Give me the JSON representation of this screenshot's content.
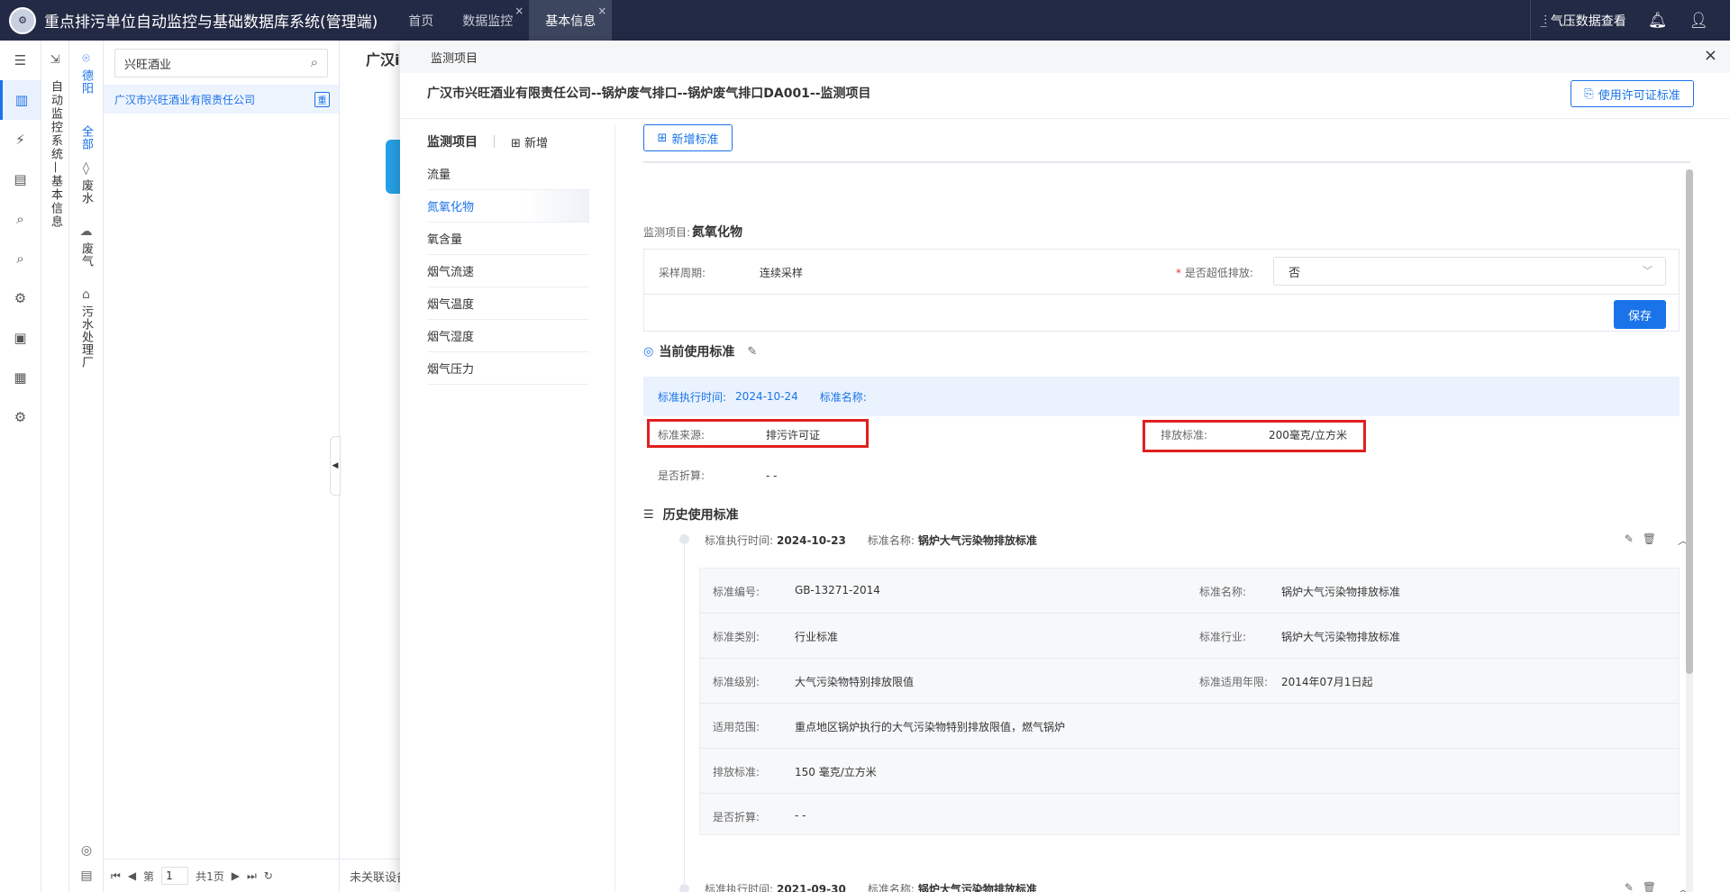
{
  "topbar": {
    "app_title": "重点排污单位自动监控与基础数据库系统(管理端)",
    "tabs": [
      {
        "label": "首页",
        "active": false,
        "closable": false
      },
      {
        "label": "数据监控",
        "active": false,
        "closable": true
      },
      {
        "label": "基本信息",
        "active": true,
        "closable": true
      }
    ],
    "close_glyph": "×",
    "right_label": "气压数据查看",
    "right_icons": [
      "chart-icon",
      "bell-icon",
      "user-icon"
    ]
  },
  "rail1": {
    "icons": [
      "menu-icon",
      "dashboard-icon",
      "money-icon",
      "report-icon",
      "search-doc-icon",
      "search-doc2-icon",
      "settings-icon",
      "image-icon",
      "card-icon",
      "config-icon"
    ]
  },
  "rail2": {
    "text": "自动监控系统—基本信息"
  },
  "rail3": {
    "items": [
      {
        "icon": "location-icon",
        "label": "德阳",
        "blue": true
      },
      {
        "icon": "",
        "label": "全部",
        "blue": true
      },
      {
        "icon": "water-drop-icon",
        "label": "废水",
        "blue": false
      },
      {
        "icon": "cloud-icon",
        "label": "废气",
        "blue": false
      },
      {
        "icon": "home-icon",
        "label": "污水处理厂",
        "blue": false
      }
    ]
  },
  "tree": {
    "search_value": "兴旺酒业",
    "company": "广汉市兴旺酒业有限责任公司",
    "badge": "重",
    "pager": {
      "prefix": "第",
      "page": "1",
      "total": "共1页"
    }
  },
  "background": {
    "title": "广汉i",
    "footer": "未关联设备"
  },
  "modal": {
    "header": "监测项目",
    "close": "×",
    "title": "广汉市兴旺酒业有限责任公司--锅炉废气排口--锅炉废气排口DA001--监测项目",
    "permit_button": "使用许可证标准",
    "list": {
      "header": "监测项目",
      "add": "新增",
      "items": [
        "流量",
        "氮氧化物",
        "氧含量",
        "烟气流速",
        "烟气温度",
        "烟气湿度",
        "烟气压力"
      ],
      "selected": 1
    },
    "add_standard_button": "新增标准",
    "project_label": "监测项目:",
    "project_value": "氮氧化物",
    "form": {
      "period_label": "采样周期:",
      "period_value": "连续采样",
      "required_mark": "*",
      "over_label": "是否超低排放:",
      "over_value": "否",
      "save": "保存"
    },
    "current": {
      "title": "当前使用标准",
      "exec_time_label": "标准执行时间:",
      "exec_time_value": "2024-10-24",
      "name_label": "标准名称:",
      "name_value": "",
      "source_label": "标准来源:",
      "source_value": "排污许可证",
      "emission_label": "排放标准:",
      "emission_value": "200毫克/立方米",
      "discount_label": "是否折算:",
      "discount_value": "- -"
    },
    "history": {
      "title": "历史使用标准",
      "entries": [
        {
          "time_label": "标准执行时间:",
          "time": "2024-10-23",
          "name_label": "标准名称:",
          "name": "锅炉大气污染物排放标准"
        },
        {
          "time_label": "标准执行时间:",
          "time": "2021-09-30",
          "name_label": "标准名称:",
          "name": "锅炉大气污染物排放标准"
        }
      ],
      "detail": {
        "code_label": "标准编号:",
        "code": "GB-13271-2014",
        "std_name_label": "标准名称:",
        "std_name": "锅炉大气污染物排放标准",
        "type_label": "标准类别:",
        "type": "行业标准",
        "industry_label": "标准行业:",
        "industry": "锅炉大气污染物排放标准",
        "level_label": "标准级别:",
        "level": "大气污染物特别排放限值",
        "year_label": "标准适用年限:",
        "year": "2014年07月1日起",
        "scope_label": "适用范围:",
        "scope": "重点地区锅炉执行的大气污染物特别排放限值，燃气锅炉",
        "emission_label": "排放标准:",
        "emission": "150 毫克/立方米",
        "discount_label": "是否折算:",
        "discount": "- -"
      }
    }
  },
  "colors": {
    "accent": "#1a73e8",
    "topbar": "#232a45",
    "highlight": "#e02020"
  }
}
